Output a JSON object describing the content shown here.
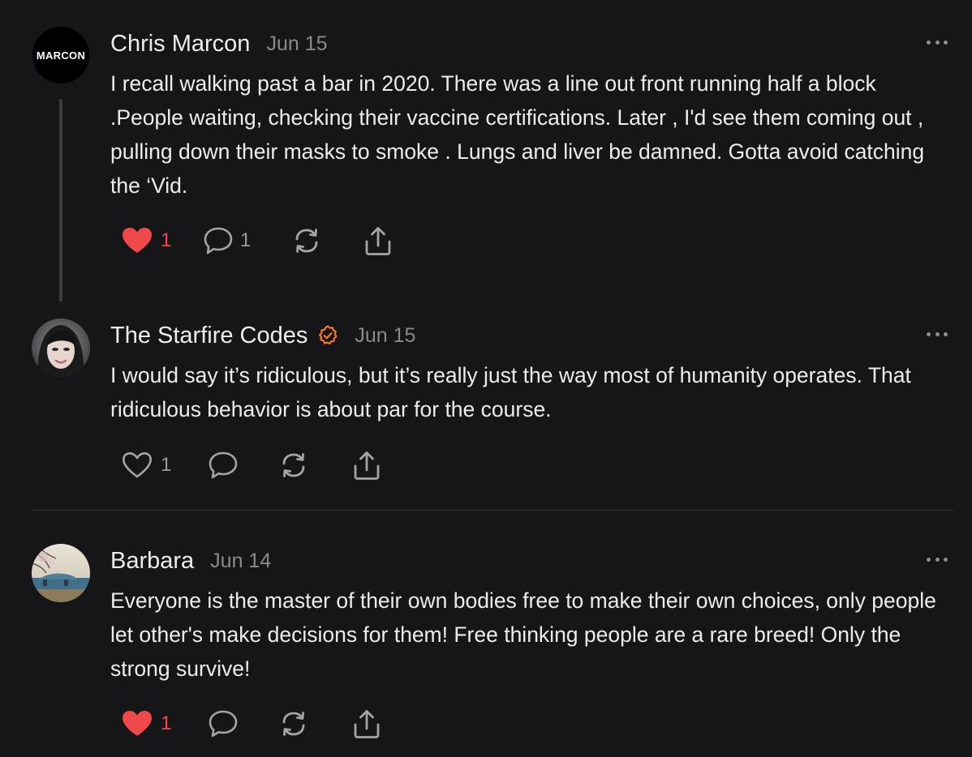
{
  "comments": [
    {
      "avatar_text": "MARCON",
      "author": "Chris Marcon",
      "date": "Jun 15",
      "verified": false,
      "text": "I recall walking past a bar in 2020. There was a line out front running half a block .People waiting, checking their vaccine certifications. Later , I'd see them coming out , pulling down their masks to smoke . Lungs and liver be damned. Gotta avoid catching the ‘Vid.",
      "likes": "1",
      "liked": true,
      "replies": "1",
      "more_icon": "ellipsis-icon"
    },
    {
      "author": "The Starfire Codes",
      "date": "Jun 15",
      "verified": true,
      "text": "I would say it’s ridiculous, but it’s really just the way most of humanity operates. That ridiculous behavior is about par for the course.",
      "likes": "1",
      "liked": false,
      "replies": "",
      "more_icon": "ellipsis-icon"
    },
    {
      "author": "Barbara",
      "date": "Jun 14",
      "verified": false,
      "text": "Everyone is the master of their own bodies free to make their own choices, only people let other's make decisions for them! Free thinking people are a rare breed! Only the strong survive!",
      "likes": "1",
      "liked": true,
      "replies": "",
      "more_icon": "ellipsis-icon"
    }
  ],
  "colors": {
    "background": "#161618",
    "like_active": "#f0494c",
    "verified_badge": "#f07a2e",
    "muted_text": "#8a8a8d"
  }
}
